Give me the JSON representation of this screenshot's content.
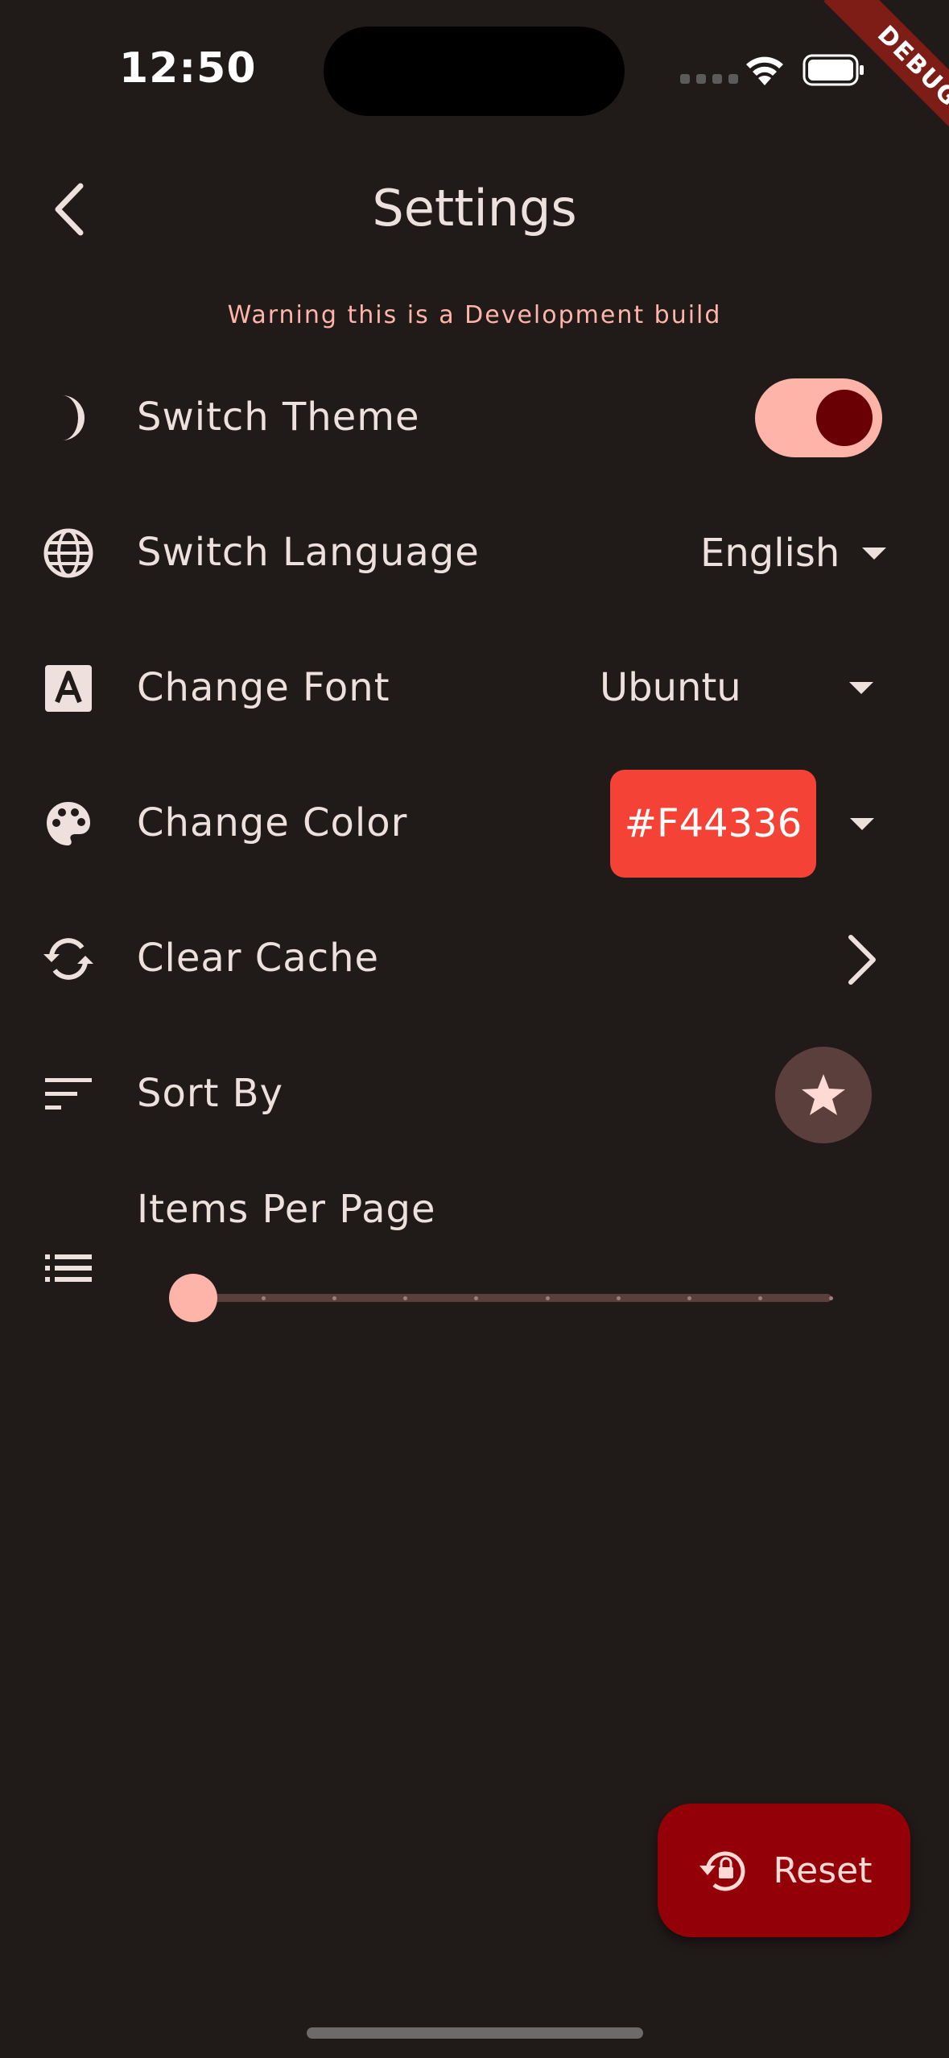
{
  "status_bar": {
    "time": "12:50"
  },
  "debug_banner": "DEBUG",
  "app_bar": {
    "title": "Settings"
  },
  "warning": "Warning this is a Development build",
  "settings": {
    "theme": {
      "label": "Switch Theme",
      "enabled": true
    },
    "language": {
      "label": "Switch Language",
      "value": "English"
    },
    "font": {
      "label": "Change Font",
      "value": "Ubuntu"
    },
    "color": {
      "label": "Change Color",
      "value": "#F44336"
    },
    "cache": {
      "label": "Clear Cache"
    },
    "sort": {
      "label": "Sort By"
    },
    "items_per_page": {
      "label": "Items Per Page",
      "slider_value": 0,
      "divisions": 9
    }
  },
  "fab": {
    "label": "Reset"
  },
  "colors": {
    "background": "#201a19",
    "accent": "#ffb4a9",
    "toggle_knob": "#690003",
    "fab": "#930007",
    "selected_color": "#f44336"
  }
}
